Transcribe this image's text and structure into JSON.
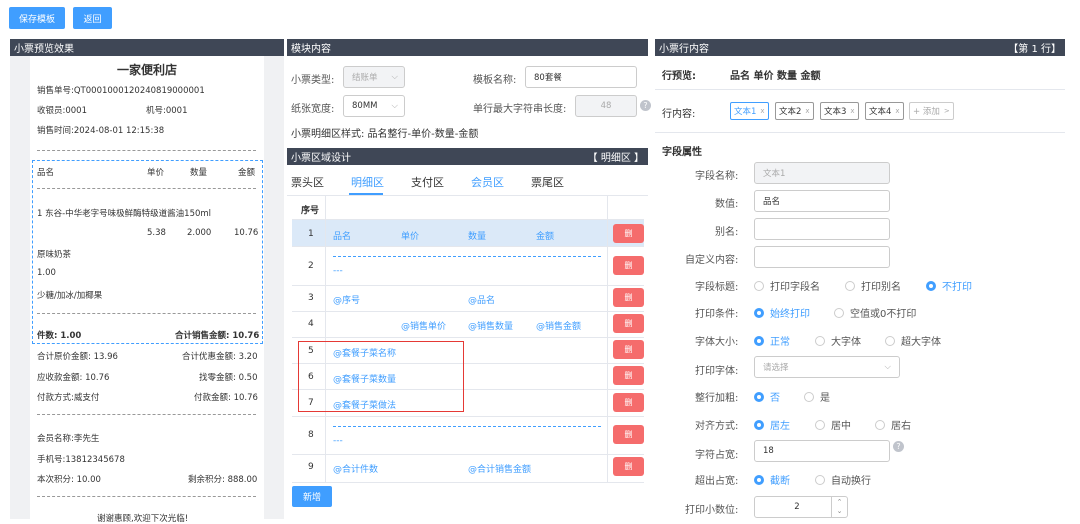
{
  "toolbar": {
    "save": "保存模板",
    "back": "返回"
  },
  "left": {
    "title": "小票预览效果",
    "store": "一家便利店",
    "order_no": "销售单号:QT0001000120240819000001",
    "cashier": "收银员:0001",
    "machine": "机号:0001",
    "time": "销售时间:2024-08-01 12:15:38",
    "headers": [
      "品名",
      "单价",
      "数量",
      "金额"
    ],
    "item1": "1 东谷-中华老字号味极鲜酶特级道酱油150ml",
    "item1_price": "5.38",
    "item1_qty": "2.000",
    "item1_amt": "10.76",
    "sub1": "原味奶茶",
    "sub_qty": "1.00",
    "sub2": "少糖/加冰/加椰果",
    "count": "件数: 1.00",
    "total": "合计销售金额: 10.76",
    "orig": "合计原价金额: 13.96",
    "disc": "合计优惠金额: 3.20",
    "receivable": "应收款金额: 10.76",
    "change": "找零金额: 0.50",
    "paymethod": "付款方式:威支付",
    "paid": "付款金额: 10.76",
    "member": "会员名称:李先生",
    "phone": "手机号:13812345678",
    "points": "本次积分: 10.00",
    "remain": "剩余积分: 888.00",
    "thanks": "谢谢惠顾,欢迎下次光临!"
  },
  "middle": {
    "title": "模块内容",
    "type_label": "小票类型:",
    "type_value": "结账单",
    "name_label": "模板名称:",
    "name_value": "80套餐",
    "width_label": "纸张宽度:",
    "width_value": "80MM",
    "maxlen_label": "单行最大字符串长度:",
    "maxlen_value": "48",
    "style": "小票明细区样式: 品名整行-单价-数量-金额",
    "design_title": "小票区域设计",
    "design_tag": "【 明细区 】",
    "tabs": [
      "票头区",
      "明细区",
      "支付区",
      "会员区",
      "票尾区"
    ],
    "col_seq": "序号",
    "del": "删",
    "rows": [
      {
        "n": "1",
        "a": "品名",
        "b": "单价",
        "c": "数量",
        "d": "金额"
      },
      {
        "n": "2",
        "dash": "---"
      },
      {
        "n": "3",
        "a": "@序号",
        "c": "@品名"
      },
      {
        "n": "4",
        "b": "@销售单价",
        "c": "@销售数量",
        "d": "@销售金额"
      },
      {
        "n": "5",
        "a": "@套餐子菜名称"
      },
      {
        "n": "6",
        "a": "@套餐子菜数量"
      },
      {
        "n": "7",
        "a": "@套餐子菜做法"
      },
      {
        "n": "8",
        "dash": "---"
      },
      {
        "n": "9",
        "a": "@合计件数",
        "c": "@合计销售金额"
      }
    ],
    "add": "新增"
  },
  "right": {
    "title": "小票行内容",
    "row_tag": "【第 1 行】",
    "preview_label": "行预览:",
    "preview_value": "品名 单价 数量 金额",
    "content_label": "行内容:",
    "tags": [
      "文本1",
      "文本2",
      "文本3",
      "文本4"
    ],
    "add_tag": "+ 添加",
    "section": "字段属性",
    "f_name": "字段名称:",
    "f_name_v": "文本1",
    "f_val": "数值:",
    "f_val_v": "品名",
    "f_alias": "别名:",
    "f_custom": "自定义内容:",
    "f_title": "字段标题:",
    "f_title_opts": [
      "打印字段名",
      "打印别名",
      "不打印"
    ],
    "f_cond": "打印条件:",
    "f_cond_opts": [
      "始终打印",
      "空值或0不打印"
    ],
    "f_size": "字体大小:",
    "f_size_opts": [
      "正常",
      "大字体",
      "超大字体"
    ],
    "f_font": "打印字体:",
    "f_font_ph": "请选择",
    "f_bold": "整行加粗:",
    "f_bold_opts": [
      "否",
      "是"
    ],
    "f_align": "对齐方式:",
    "f_align_opts": [
      "居左",
      "居中",
      "居右"
    ],
    "f_width": "字符占宽:",
    "f_width_v": "18",
    "f_over": "超出占宽:",
    "f_over_opts": [
      "截断",
      "自动换行"
    ],
    "f_dec": "打印小数位:",
    "f_dec_v": "2"
  },
  "colors": {
    "accent": "#409eff",
    "danger": "#f56c6c",
    "header": "#3f4756",
    "highlight": "#e53935"
  }
}
